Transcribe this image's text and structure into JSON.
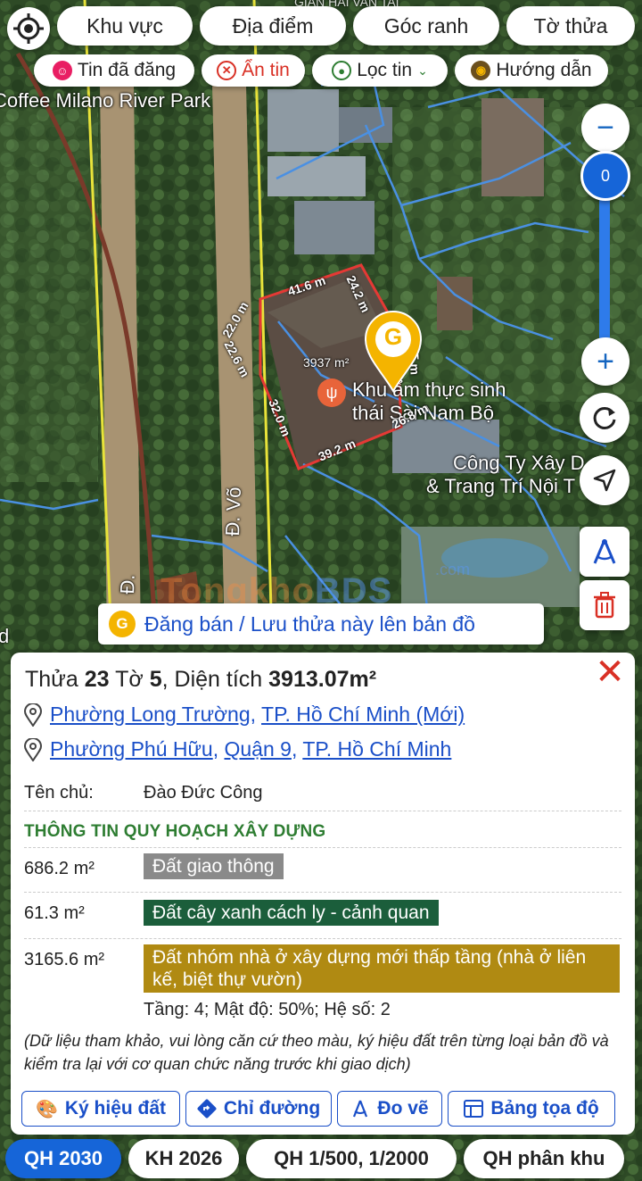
{
  "top_filters": {
    "area": "Khu vực",
    "location": "Địa điểm",
    "corner": "Góc ranh",
    "sheet": "Tờ thửa"
  },
  "sub_filters": {
    "posted": "Tin đã đăng",
    "hide": "Ẩn tin",
    "filter": "Lọc tin",
    "guide": "Hướng dẫn"
  },
  "map": {
    "labels": {
      "coffee": "Coffee Milano River Park",
      "restaurant_1": "Khu ẩm thực sinh",
      "restaurant_2": "thái Sài Nam Bộ",
      "company_1": "Công Ty Xây D",
      "company_2": "& Trang Trí Nội T",
      "road_1": "Đ. Võ",
      "road_2": "Đ.",
      "left_edge": "d",
      "top_cut": "GIAN HAI VAN TAI"
    },
    "measurements": {
      "top": "41.6 m",
      "top_right": "24.2 m",
      "left_upper": "22.0 m",
      "left_lower": "22.6 m",
      "right": "27.5 m",
      "center_area": "3937 m²",
      "left_bottom": "32.0 m",
      "bottom": "39.2 m",
      "bottom_right": "26.8 m"
    },
    "zoom_level": "0",
    "watermark": {
      "part1": "Tongkho",
      "part2": "BDS",
      "com": ".com"
    },
    "post_button": "Đăng bán / Lưu thửa này lên bản đồ",
    "marker_letter": "G",
    "colors": {
      "parcel_outline": "#e53935",
      "lot_lines": "#4a90e2",
      "road_lines": "#e8e33a",
      "marker": "#f4b400",
      "primary": "#1665d8"
    }
  },
  "panel": {
    "title": {
      "lot_label": "Thửa",
      "lot_no": "23",
      "sheet_label": "Tờ",
      "sheet_no": "5",
      "area_label": ", Diện tích",
      "area_value": "3913.07m²"
    },
    "address_1": {
      "ward": "Phường Long Trường",
      "sep": ",",
      "city": "TP. Hồ Chí Minh (Mới)"
    },
    "address_2": {
      "ward": "Phường Phú Hữu",
      "sep1": ",",
      "district": "Quận 9",
      "sep2": ",",
      "city": "TP. Hồ Chí Minh"
    },
    "owner": {
      "label": "Tên chủ:",
      "value": "Đào Đức Công"
    },
    "section_title": "THÔNG TIN QUY HOẠCH XÂY DỰNG",
    "zones": [
      {
        "area": "686.2 m²",
        "type": "Đất giao thông",
        "color": "#8a8a8a"
      },
      {
        "area": "61.3 m²",
        "type": "Đất cây xanh cách ly - cảnh quan",
        "color": "#1b5e3b"
      },
      {
        "area": "3165.6 m²",
        "type": "Đất nhóm nhà ở xây dựng mới thấp tầng (nhà ở liên kế, biệt thự vườn)",
        "color": "#b08a12"
      }
    ],
    "zone_meta": "Tầng: 4; Mật độ: 50%; Hệ số: 2",
    "note": "(Dữ liệu tham khảo, vui lòng căn cứ theo màu, ký hiệu đất trên từng loại bản đồ và kiểm tra lại với cơ quan chức năng trước khi giao dịch)",
    "close_icon": "close-icon",
    "tools": {
      "legend": "Ký hiệu đất",
      "directions": "Chỉ đường",
      "measure": "Đo vẽ",
      "coords": "Bảng tọa độ"
    }
  },
  "layers": {
    "qh2030": "QH 2030",
    "kh2026": "KH 2026",
    "qh1500": "QH 1/500, 1/2000",
    "qhpk": "QH phân khu",
    "active": "QH 2030"
  }
}
